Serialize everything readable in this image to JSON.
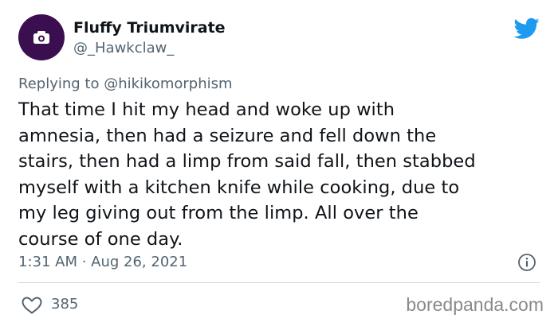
{
  "author": {
    "display_name": "Fluffy Triumvirate",
    "handle": "@_Hawkclaw_",
    "avatar_icon": "camera-icon",
    "avatar_color": "#3b0f4f"
  },
  "reply": {
    "prefix": "Replying to",
    "to_handle": "@hikikomorphism"
  },
  "tweet": {
    "lines": [
      "That time I hit my head and woke up with",
      "amnesia, then had a seizure and fell down the",
      "stairs, then had a limp from said fall, then stabbed",
      "myself with a kitchen knife while cooking, due to",
      "my leg giving out from the limp. All over the",
      "course of one day."
    ],
    "timestamp": "1:31 AM · Aug 26, 2021"
  },
  "stats": {
    "likes": "385"
  },
  "icons": {
    "brand": "twitter-bird-icon",
    "info": "info-icon",
    "like": "heart-icon"
  },
  "colors": {
    "twitter_blue": "#1d9bf0",
    "secondary_text": "#536471"
  },
  "watermark": "boredpanda.com"
}
